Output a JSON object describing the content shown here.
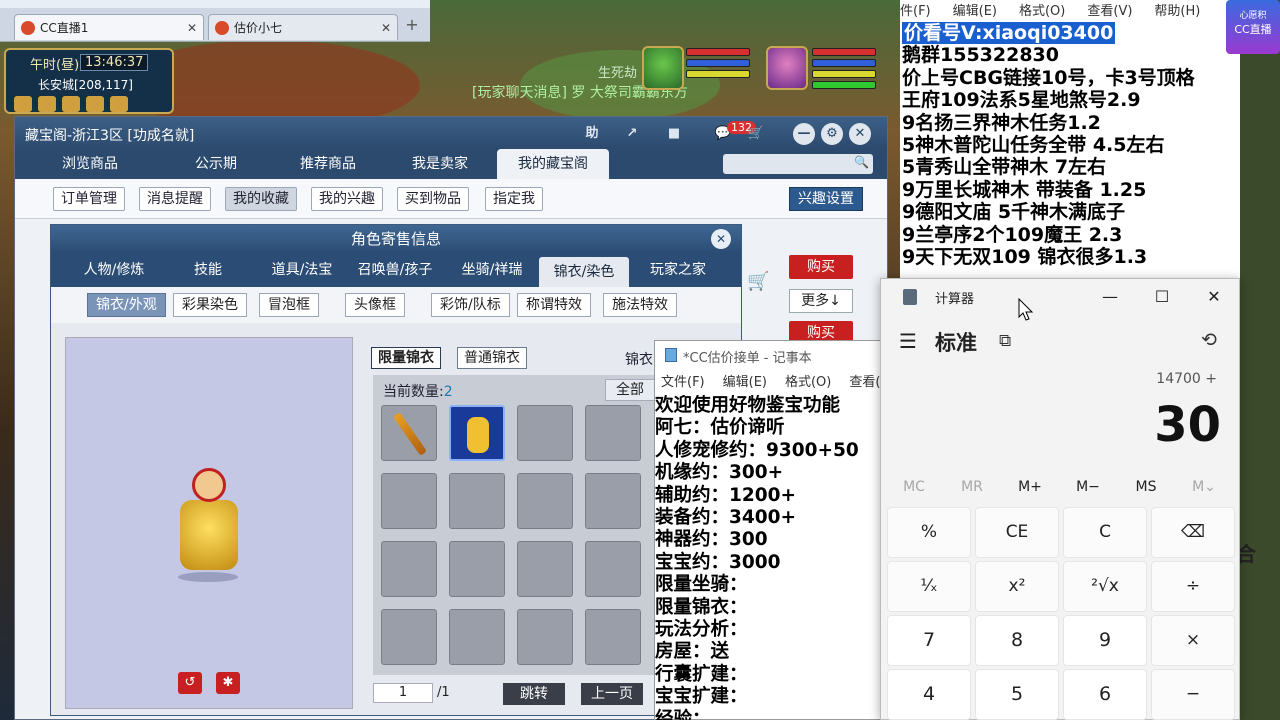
{
  "browser": {
    "tabs": [
      {
        "label": "CC直播1",
        "close": "✕"
      },
      {
        "label": "估价小七",
        "close": "✕"
      }
    ],
    "new_tab": "+"
  },
  "hud": {
    "time_period": "午时(昼)",
    "clock": "13:46:37",
    "location": "长安城[208,117]",
    "scroll_text": "[玩家聊天消息] 罗 大祭司霸霸东方",
    "scroll_text2": "生死劫"
  },
  "cbg": {
    "title": "藏宝阁-浙江3区 [功成名就]",
    "help": "助",
    "message_count": "132",
    "nav": [
      "浏览商品",
      "公示期",
      "推荐商品",
      "我是卖家",
      "我的藏宝阁"
    ],
    "sub": [
      "订单管理",
      "消息提醒",
      "我的收藏",
      "我的兴趣",
      "买到物品",
      "指定我"
    ],
    "interest_settings": "兴趣设置",
    "buy": "购买",
    "more": "更多↓"
  },
  "role": {
    "title": "角色寄售信息",
    "tabs": [
      "人物/修炼",
      "技能",
      "道具/法宝",
      "召唤兽/孩子",
      "坐骑/祥瑞",
      "锦衣/染色",
      "玩家之家"
    ],
    "subtabs": [
      "锦衣/外观",
      "彩果染色",
      "冒泡框",
      "头像框",
      "彩饰/队标",
      "称谓特效",
      "施法特效"
    ],
    "kinds": [
      "限量锦衣",
      "普通锦衣"
    ],
    "kind_label": "锦衣",
    "count_label": "当前数量:",
    "count": "2",
    "all": "全部",
    "page": "1",
    "page_total": "/1",
    "jump": "跳转",
    "prev": "上一页"
  },
  "notepad_right": {
    "menu": [
      "件(F)",
      "编辑(E)",
      "格式(O)",
      "查看(V)",
      "帮助(H)"
    ],
    "lines": [
      "价看号V:xiaoqi03400",
      "鹅群155322830",
      "价上号CBG链接10号，卡3号顶格",
      "王府109法系5星地煞号2.9",
      "9名扬三界神木任务1.2",
      "5神木普陀山任务全带 4.5左右",
      "5青秀山全带神木  7左右",
      "9万里长城神木 带装备  1.25",
      "9德阳文庙 5千神木满底子",
      "9兰亭序2个109魔王 2.3",
      "9天下无双109  锦衣很多1.3"
    ],
    "side_glyph": "合"
  },
  "logo": {
    "line1": "心愿积",
    "line2": "CC直播"
  },
  "notepad_mid": {
    "title": "*CC估价接单 - 记事本",
    "menu": [
      "文件(F)",
      "编辑(E)",
      "格式(O)",
      "查看(V)"
    ],
    "lines": [
      "欢迎使用好物鉴宝功能",
      "阿七：估价谛听",
      "人修宠修约：9300+50",
      "机缘约：300+",
      "辅助约：1200+",
      "装备约：3400+",
      "神器约：300",
      "宝宝约：3000",
      "限量坐骑：",
      "限量锦衣：",
      "玩法分析：",
      "房屋：送",
      "行囊扩建：",
      "宝宝扩建：",
      "经验："
    ]
  },
  "calc": {
    "title": "计算器",
    "mode": "标准",
    "expression": "14700 +",
    "display": "30",
    "memory": [
      "MC",
      "MR",
      "M+",
      "M−",
      "MS",
      "M⌄"
    ],
    "keys": [
      [
        "%",
        "CE",
        "C",
        "⌫"
      ],
      [
        "¹⁄ₓ",
        "x²",
        "²√x",
        "÷"
      ],
      [
        "7",
        "8",
        "9",
        "×"
      ],
      [
        "4",
        "5",
        "6",
        "−"
      ]
    ]
  }
}
